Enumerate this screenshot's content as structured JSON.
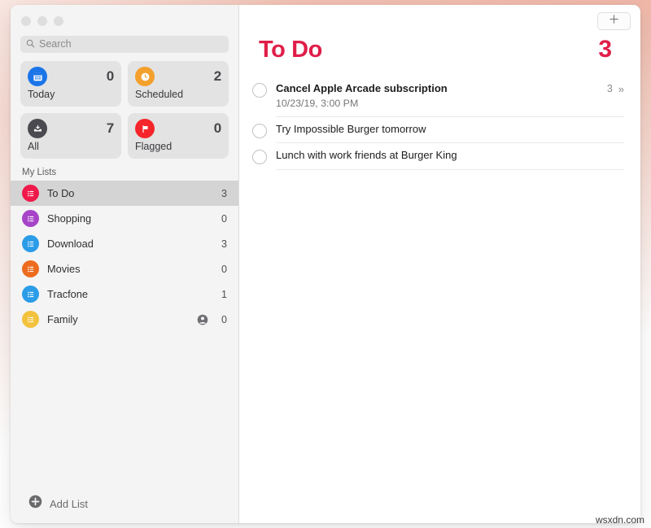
{
  "window": {
    "traffic_lights": [
      "close",
      "minimize",
      "zoom"
    ]
  },
  "sidebar": {
    "search": {
      "placeholder": "Search",
      "value": "",
      "icon": "search-icon"
    },
    "smart_lists": [
      {
        "label": "Today",
        "count": "0",
        "icon": "calendar-icon",
        "color": "#1b75e8"
      },
      {
        "label": "Scheduled",
        "count": "2",
        "icon": "clock-icon",
        "color": "#f3a02c"
      },
      {
        "label": "All",
        "count": "7",
        "icon": "tray-icon",
        "color": "#4a4a50"
      },
      {
        "label": "Flagged",
        "count": "0",
        "icon": "flag-icon",
        "color": "#f5262b"
      }
    ],
    "section_title": "My Lists",
    "lists": [
      {
        "label": "To Do",
        "count": "3",
        "color": "#f0194a",
        "icon": "list-icon",
        "selected": true,
        "shared": false
      },
      {
        "label": "Shopping",
        "count": "0",
        "color": "#a645c8",
        "icon": "list-icon",
        "selected": false,
        "shared": false
      },
      {
        "label": "Download",
        "count": "3",
        "color": "#2a9ce8",
        "icon": "list-icon",
        "selected": false,
        "shared": false
      },
      {
        "label": "Movies",
        "count": "0",
        "color": "#ed6b1f",
        "icon": "list-icon",
        "selected": false,
        "shared": false
      },
      {
        "label": "Tracfone",
        "count": "1",
        "color": "#2a9ce8",
        "icon": "list-icon",
        "selected": false,
        "shared": false
      },
      {
        "label": "Family",
        "count": "0",
        "color": "#f3c23c",
        "icon": "list-icon",
        "selected": false,
        "shared": true
      }
    ],
    "add_list": {
      "label": "Add List",
      "icon": "plus-circle-icon"
    }
  },
  "main": {
    "add_reminder_button": {
      "icon": "plus-icon"
    },
    "title": "To Do",
    "total_count": "3",
    "accent_color": "#e01e49",
    "reminders": [
      {
        "title": "Cancel Apple Arcade subscription",
        "subtitle": "10/23/19, 3:00 PM",
        "bold": true,
        "meta_count": "3",
        "has_detail_chevron": true
      },
      {
        "title": "Try Impossible Burger tomorrow",
        "subtitle": "",
        "bold": false,
        "meta_count": "",
        "has_detail_chevron": false
      },
      {
        "title": "Lunch with work friends at Burger King",
        "subtitle": "",
        "bold": false,
        "meta_count": "",
        "has_detail_chevron": false
      }
    ]
  },
  "watermark": "wsxdn.com"
}
